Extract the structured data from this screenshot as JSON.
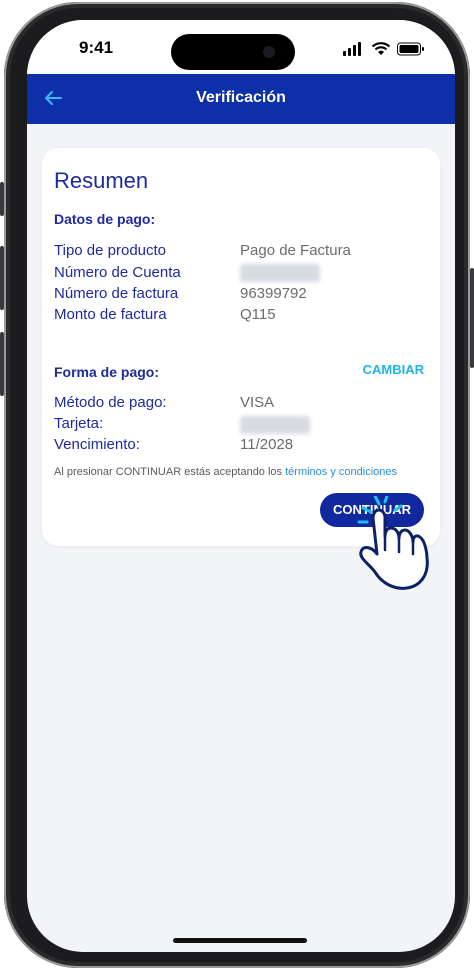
{
  "status_bar": {
    "time": "9:41"
  },
  "app_bar": {
    "title": "Verificación",
    "back_icon": "arrow-left-icon"
  },
  "summary": {
    "title": "Resumen",
    "payment_data": {
      "heading": "Datos de pago:",
      "rows": [
        {
          "label": "Tipo de producto",
          "value": "Pago de Factura"
        },
        {
          "label": "Número de Cuenta",
          "value": ""
        },
        {
          "label": "Número de factura",
          "value": "96399792"
        },
        {
          "label": "Monto de factura",
          "value": "Q115"
        }
      ]
    },
    "payment_method": {
      "heading": "Forma de pago:",
      "change_label": "CAMBIAR",
      "rows": [
        {
          "label": "Método de pago:",
          "value": "VISA"
        },
        {
          "label": "Tarjeta:",
          "value": ""
        },
        {
          "label": "Vencimiento:",
          "value": "11/2028"
        }
      ]
    },
    "terms_text": "Al presionar CONTINUAR estás aceptando los",
    "terms_link": "términos y condiciones",
    "continue_label": "CONTINUAR"
  },
  "colors": {
    "app_bar": "#0d2fa8",
    "primary_text": "#1f2a9e",
    "accent": "#20b4e6",
    "button": "#12289e"
  }
}
